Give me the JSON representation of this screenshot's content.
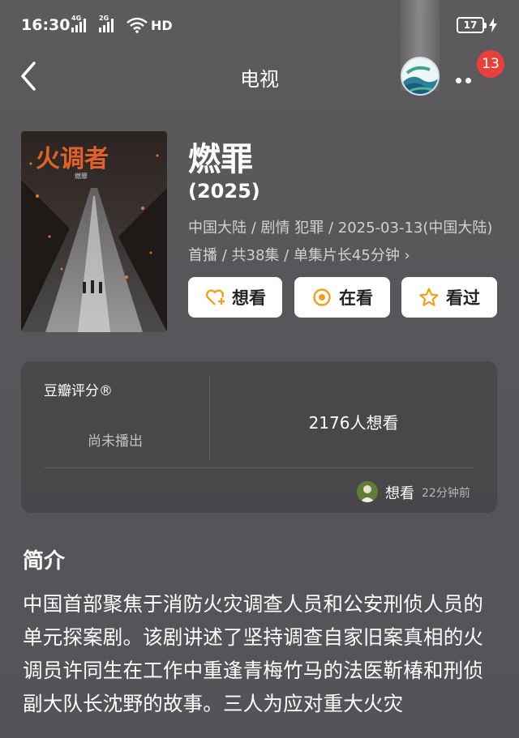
{
  "status_bar": {
    "time": "16:30",
    "signal1_tag": "4G",
    "signal2_tag": "2G",
    "network": "HD",
    "battery": "17"
  },
  "nav": {
    "title": "电视",
    "notification_count": "13"
  },
  "show": {
    "title": "燃罪",
    "year": "(2025)",
    "meta": "中国大陆 / 剧情 犯罪 / 2025-03-13(中国大陆)首播 / 共38集 / 单集片长45分钟 ›"
  },
  "poster": {
    "title_text": "火调者",
    "subtitle_text": "燃罪"
  },
  "actions": [
    {
      "label": "想看",
      "icon": "heart-plus-icon"
    },
    {
      "label": "在看",
      "icon": "target-icon"
    },
    {
      "label": "看过",
      "icon": "star-icon"
    }
  ],
  "rating": {
    "label": "豆瓣评分®",
    "status": "尚未播出",
    "want_count": "2176人想看",
    "friend_action": "想看",
    "friend_time": "22分钟前"
  },
  "synopsis": {
    "heading": "简介",
    "text": "中国首部聚焦于消防火灾调查人员和公安刑侦人员的单元探案剧。该剧讲述了坚持调查自家旧案真相的火调员许同生在工作中重逢青梅竹马的法医靳椿和刑侦副大队长沈野的故事。三人为应对重大火灾"
  },
  "colors": {
    "background": "#5a585b",
    "badge": "#e8413c",
    "accent_orange": "#f0a020"
  }
}
